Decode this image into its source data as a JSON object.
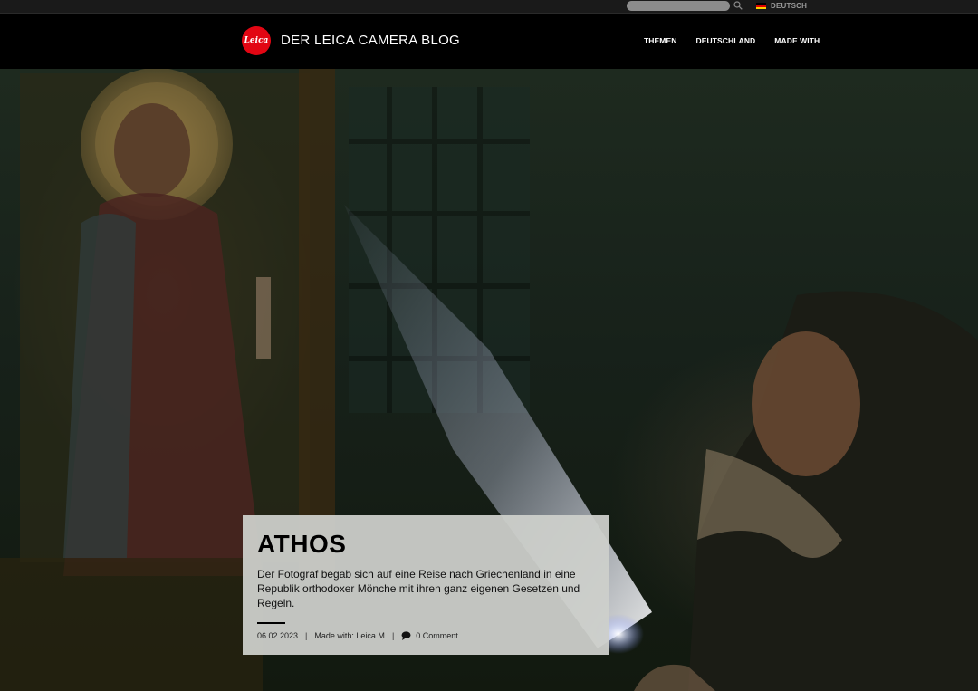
{
  "utility": {
    "search": {
      "placeholder": "",
      "value": ""
    },
    "language": {
      "label": "DEUTSCH",
      "flag_colors": [
        "#000000",
        "#dd0000",
        "#ffce00"
      ]
    }
  },
  "header": {
    "logo_text": "Leica",
    "site_title": "DER LEICA CAMERA BLOG",
    "nav": [
      "THEMEN",
      "DEUTSCHLAND",
      "MADE WITH"
    ]
  },
  "article": {
    "title": "ATHOS",
    "excerpt": "Der Fotograf begab sich auf eine Reise nach Griechenland in eine Republik orthodoxer Mönche mit ihren ganz eigenen Gesetzen und Regeln.",
    "date": "06.02.2023",
    "made_with": "Made with: Leica M",
    "comments": "0 Comment"
  },
  "colors": {
    "brand_red": "#e20613",
    "header_bg": "#000000",
    "card_bg": "#cdcfcb"
  }
}
